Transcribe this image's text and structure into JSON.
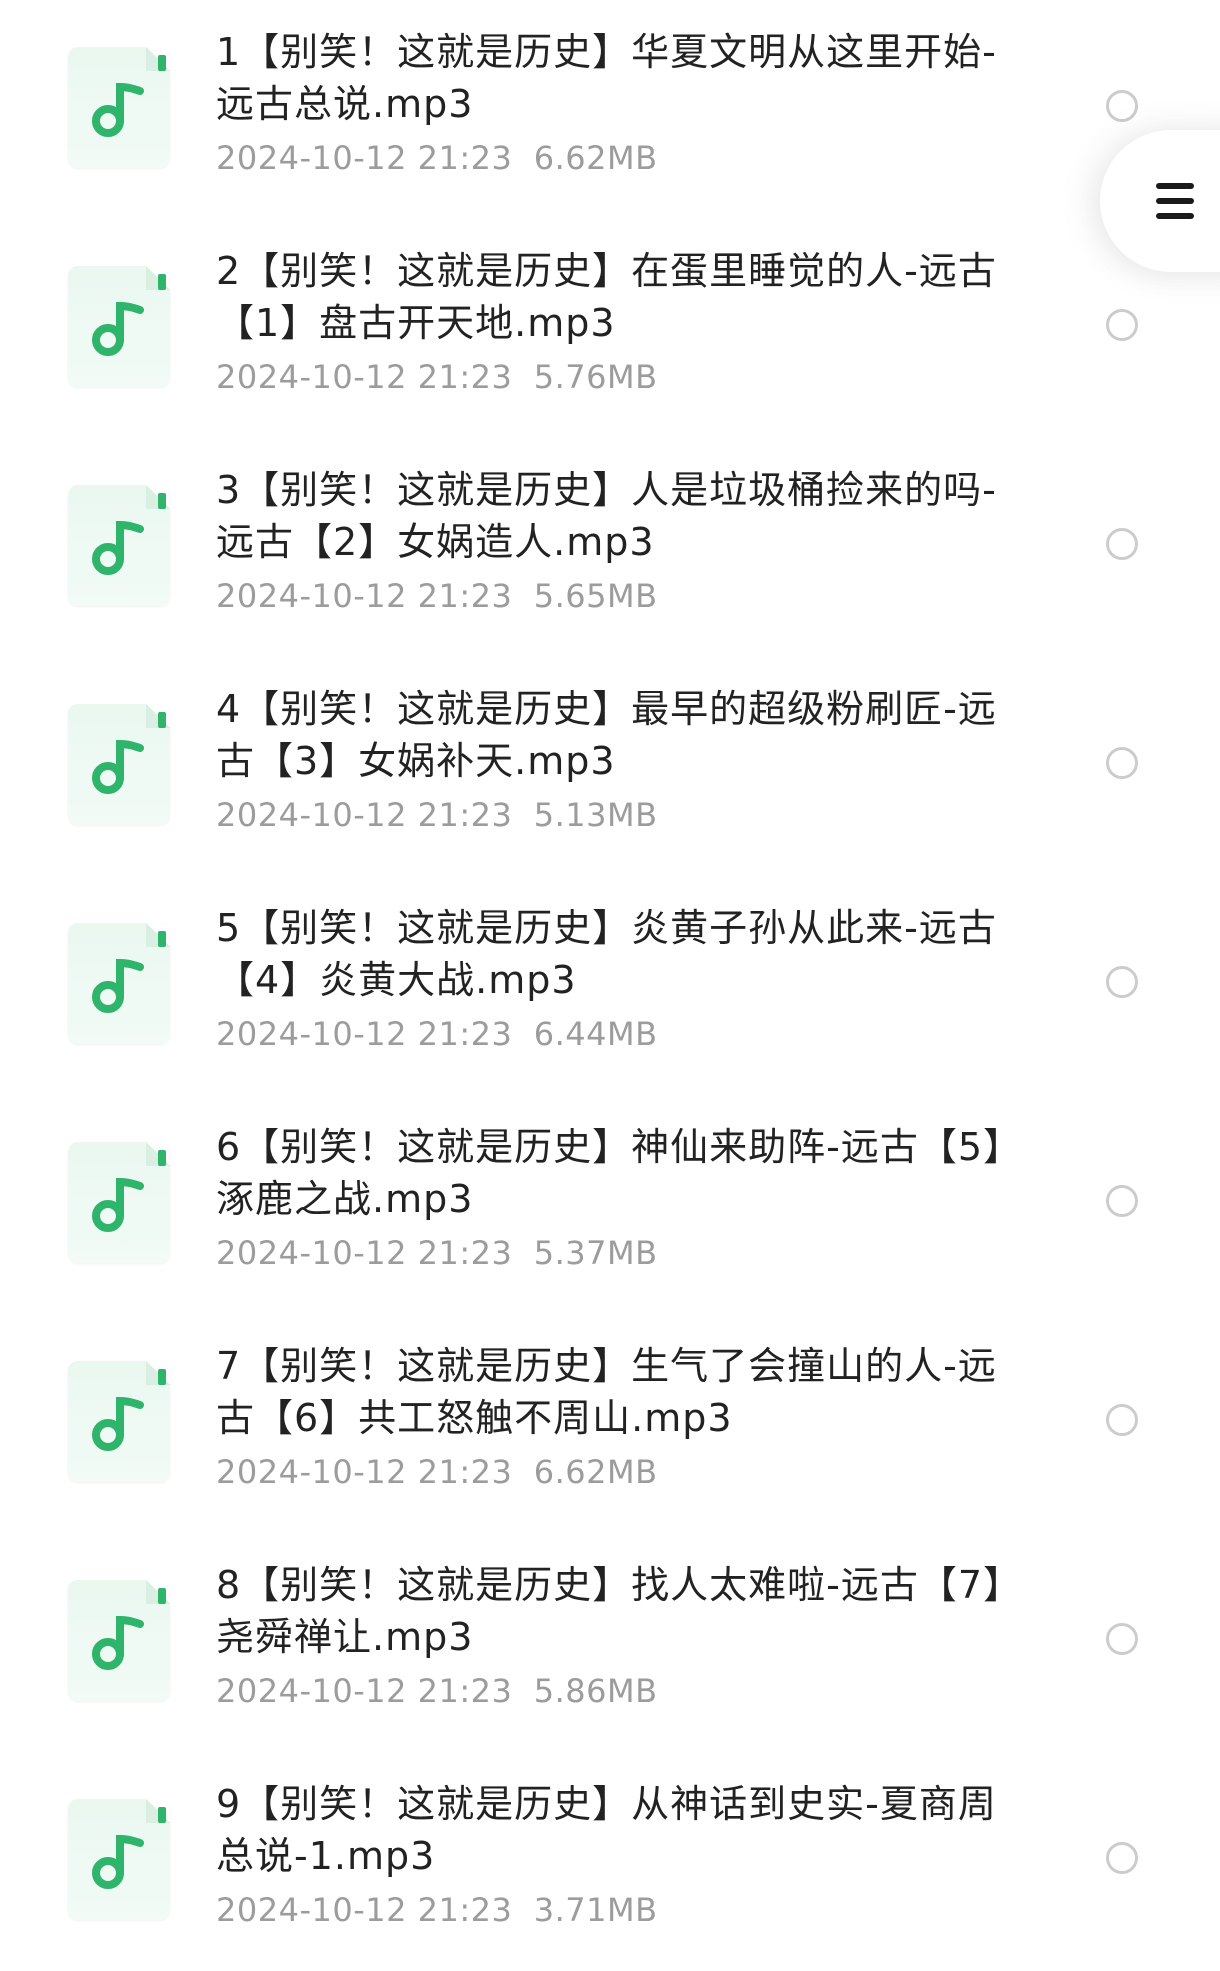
{
  "files": [
    {
      "name": "1【别笑！这就是历史】华夏文明从这里开始-远古总说.mp3",
      "date": "2024-10-12 21:23",
      "size": "6.62MB"
    },
    {
      "name": "2【别笑！这就是历史】在蛋里睡觉的人-远古【1】盘古开天地.mp3",
      "date": "2024-10-12 21:23",
      "size": "5.76MB"
    },
    {
      "name": "3【别笑！这就是历史】人是垃圾桶捡来的吗-远古【2】女娲造人.mp3",
      "date": "2024-10-12 21:23",
      "size": "5.65MB"
    },
    {
      "name": "4【别笑！这就是历史】最早的超级粉刷匠-远古【3】女娲补天.mp3",
      "date": "2024-10-12 21:23",
      "size": "5.13MB"
    },
    {
      "name": "5【别笑！这就是历史】炎黄子孙从此来-远古【4】炎黄大战.mp3",
      "date": "2024-10-12 21:23",
      "size": "6.44MB"
    },
    {
      "name": "6【别笑！这就是历史】神仙来助阵-远古【5】涿鹿之战.mp3",
      "date": "2024-10-12 21:23",
      "size": "5.37MB"
    },
    {
      "name": "7【别笑！这就是历史】生气了会撞山的人-远古【6】共工怒触不周山.mp3",
      "date": "2024-10-12 21:23",
      "size": "6.62MB"
    },
    {
      "name": "8【别笑！这就是历史】找人太难啦-远古【7】尧舜禅让.mp3",
      "date": "2024-10-12 21:23",
      "size": "5.86MB"
    },
    {
      "name": "9【别笑！这就是历史】从神话到史实-夏商周总说-1.mp3",
      "date": "2024-10-12 21:23",
      "size": "3.71MB"
    }
  ],
  "icons": {
    "file_type": "music-note-icon",
    "menu": "menu-icon",
    "select": "radio-button-unchecked"
  },
  "colors": {
    "accent_green": "#2fb46b",
    "meta_gray": "#9c9c9c"
  }
}
